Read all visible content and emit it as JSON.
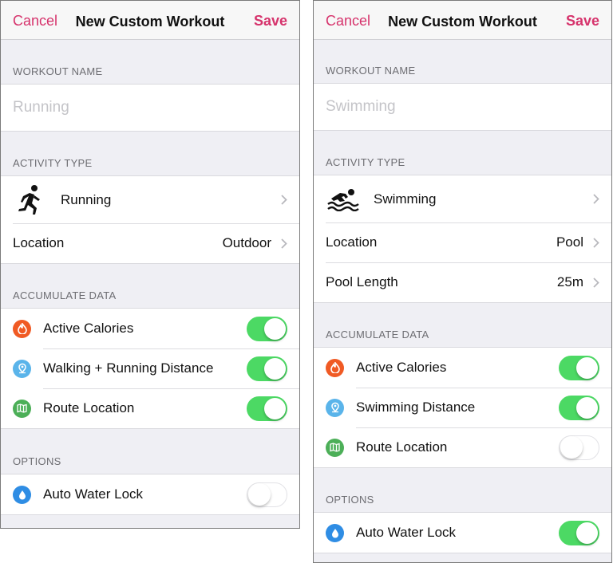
{
  "colors": {
    "accent": "#d6336c",
    "toggle_on": "#4cd964",
    "calories": "#f05a24",
    "distance": "#5ab4ea",
    "route": "#4caf58",
    "water": "#2f8de4"
  },
  "screens": [
    {
      "nav": {
        "cancel": "Cancel",
        "title": "New Custom Workout",
        "save": "Save"
      },
      "workout_name": {
        "header": "WORKOUT NAME",
        "placeholder": "Running"
      },
      "activity": {
        "header": "ACTIVITY TYPE",
        "type_icon": "running-figure-icon",
        "type": "Running",
        "location_label": "Location",
        "location_value": "Outdoor"
      },
      "accumulate": {
        "header": "ACCUMULATE DATA",
        "items": [
          {
            "label": "Active Calories",
            "icon": "flame-icon",
            "on": true
          },
          {
            "label": "Walking + Running Distance",
            "icon": "location-pin-icon",
            "on": true
          },
          {
            "label": "Route Location",
            "icon": "map-icon",
            "on": true
          }
        ]
      },
      "options": {
        "header": "OPTIONS",
        "items": [
          {
            "label": "Auto Water Lock",
            "icon": "water-drop-icon",
            "on": false
          }
        ]
      }
    },
    {
      "nav": {
        "cancel": "Cancel",
        "title": "New Custom Workout",
        "save": "Save"
      },
      "workout_name": {
        "header": "WORKOUT NAME",
        "placeholder": "Swimming"
      },
      "activity": {
        "header": "ACTIVITY TYPE",
        "type_icon": "swimmer-icon",
        "type": "Swimming",
        "location_label": "Location",
        "location_value": "Pool",
        "pool_label": "Pool Length",
        "pool_value": "25m"
      },
      "accumulate": {
        "header": "ACCUMULATE DATA",
        "items": [
          {
            "label": "Active Calories",
            "icon": "flame-icon",
            "on": true
          },
          {
            "label": "Swimming Distance",
            "icon": "location-pin-icon",
            "on": true
          },
          {
            "label": "Route Location",
            "icon": "map-icon",
            "on": false
          }
        ]
      },
      "options": {
        "header": "OPTIONS",
        "items": [
          {
            "label": "Auto Water Lock",
            "icon": "water-drop-icon",
            "on": true
          }
        ]
      }
    }
  ]
}
